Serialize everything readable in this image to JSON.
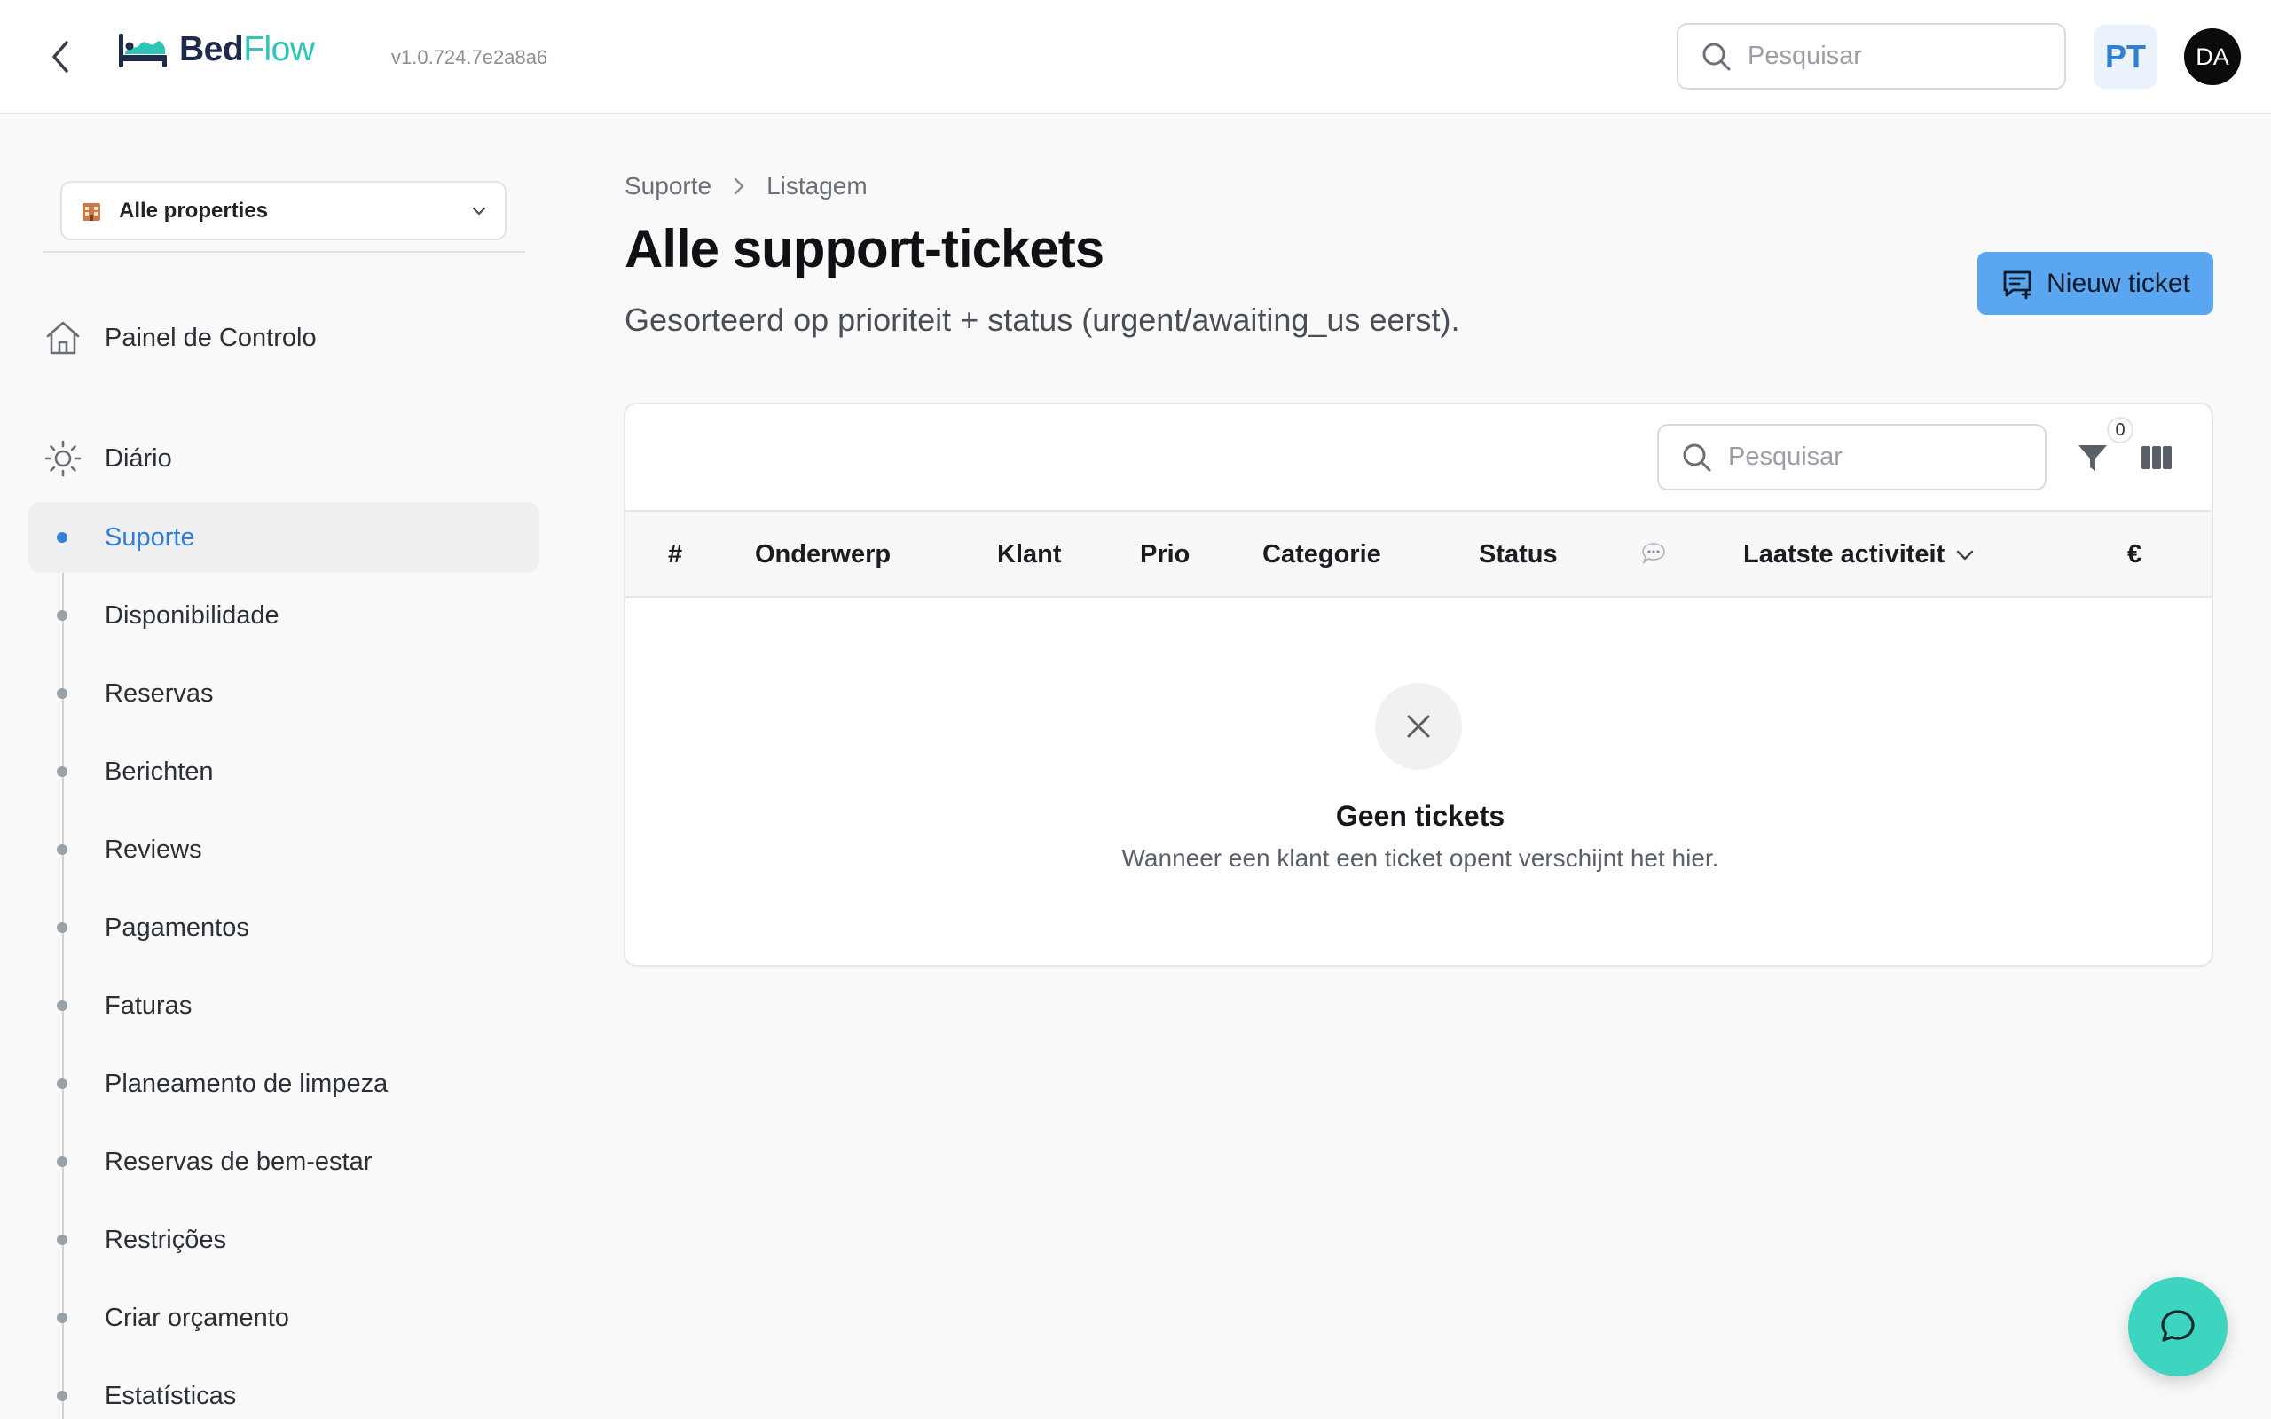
{
  "header": {
    "logo_part1": "Bed",
    "logo_part2": "Flow",
    "version": "v1.0.724.7e2a8a6",
    "search_placeholder": "Pesquisar",
    "language": "PT",
    "avatar_initials": "DA"
  },
  "sidebar": {
    "property_select": "Alle properties",
    "dashboard": "Painel de Controlo",
    "daily": "Diário",
    "items": [
      {
        "label": "Suporte",
        "active": true
      },
      {
        "label": "Disponibilidade"
      },
      {
        "label": "Reservas"
      },
      {
        "label": "Berichten"
      },
      {
        "label": "Reviews"
      },
      {
        "label": "Pagamentos"
      },
      {
        "label": "Faturas"
      },
      {
        "label": "Planeamento de limpeza"
      },
      {
        "label": "Reservas de bem-estar"
      },
      {
        "label": "Restrições"
      },
      {
        "label": "Criar orçamento"
      },
      {
        "label": "Estatísticas"
      }
    ]
  },
  "main": {
    "breadcrumb": [
      "Suporte",
      "Listagem"
    ],
    "title": "Alle support-tickets",
    "subtitle": "Gesorteerd op prioriteit + status (urgent/awaiting_us eerst).",
    "new_button": "Nieuw ticket",
    "table": {
      "search_placeholder": "Pesquisar",
      "filter_count": "0",
      "columns": [
        "#",
        "Onderwerp",
        "Klant",
        "Prio",
        "Categorie",
        "Status",
        "Laatste activiteit",
        "€"
      ],
      "empty_title": "Geen tickets",
      "empty_text": "Wanneer een klant een ticket opent verschijnt het hier."
    }
  },
  "colors": {
    "accent": "#2f7fd6",
    "button": "#5aa6f0",
    "chat_fab": "#3dd4c0"
  }
}
